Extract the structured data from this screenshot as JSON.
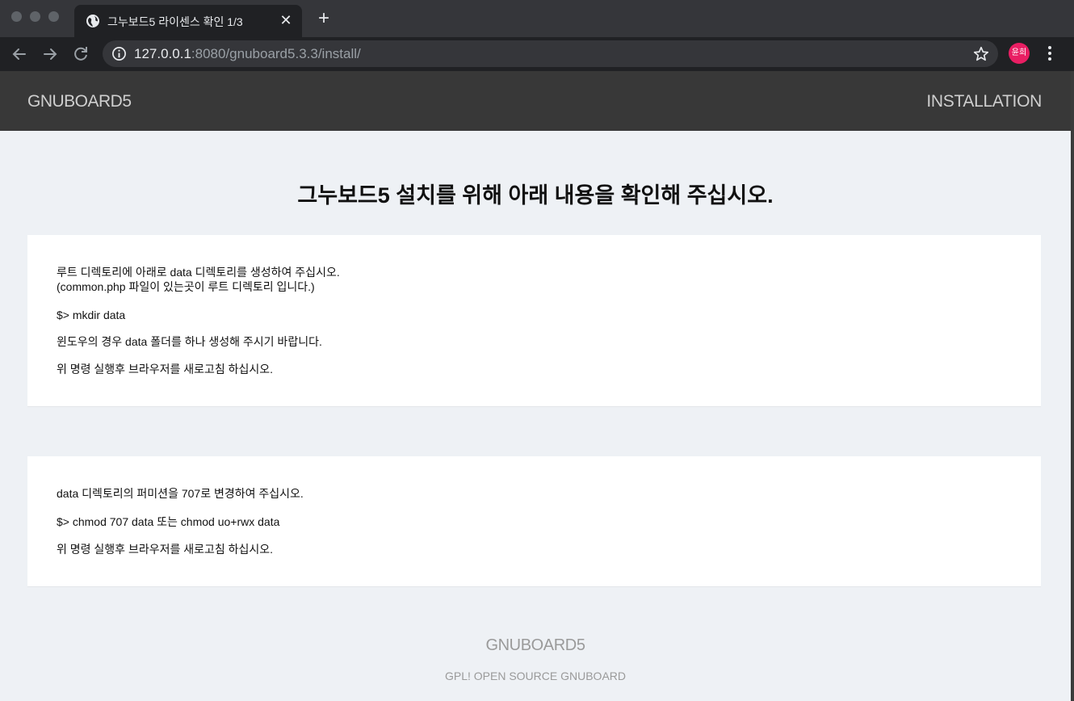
{
  "browser": {
    "tab_title": "그누보드5 라이센스 확인 1/3",
    "url_host": "127.0.0.1",
    "url_rest": ":8080/gnuboard5.3.3/install/",
    "profile_initials": "윤희",
    "profile_color": "#e91e63"
  },
  "header": {
    "logo": "GNUBOARD5",
    "right_label": "INSTALLATION"
  },
  "main": {
    "title": "그누보드5 설치를 위해 아래 내용을 확인해 주십시오.",
    "panel1": {
      "line1": "루트 디렉토리에 아래로 data 디렉토리를 생성하여 주십시오.",
      "line2": "(common.php 파일이 있는곳이 루트 디렉토리 입니다.)",
      "command": "$> mkdir data",
      "windows_note": "윈도우의 경우 data 폴더를 하나 생성해 주시기 바랍니다.",
      "refresh_note": "위 명령 실행후 브라우저를 새로고침 하십시오."
    },
    "panel2": {
      "line1": "data 디렉토리의 퍼미션을 707로 변경하여 주십시오.",
      "command": "$> chmod 707 data 또는 chmod uo+rwx data",
      "refresh_note": "위 명령 실행후 브라우저를 새로고침 하십시오."
    }
  },
  "footer": {
    "logo": "GNUBOARD5",
    "tagline": "GPL! OPEN SOURCE GNUBOARD"
  }
}
